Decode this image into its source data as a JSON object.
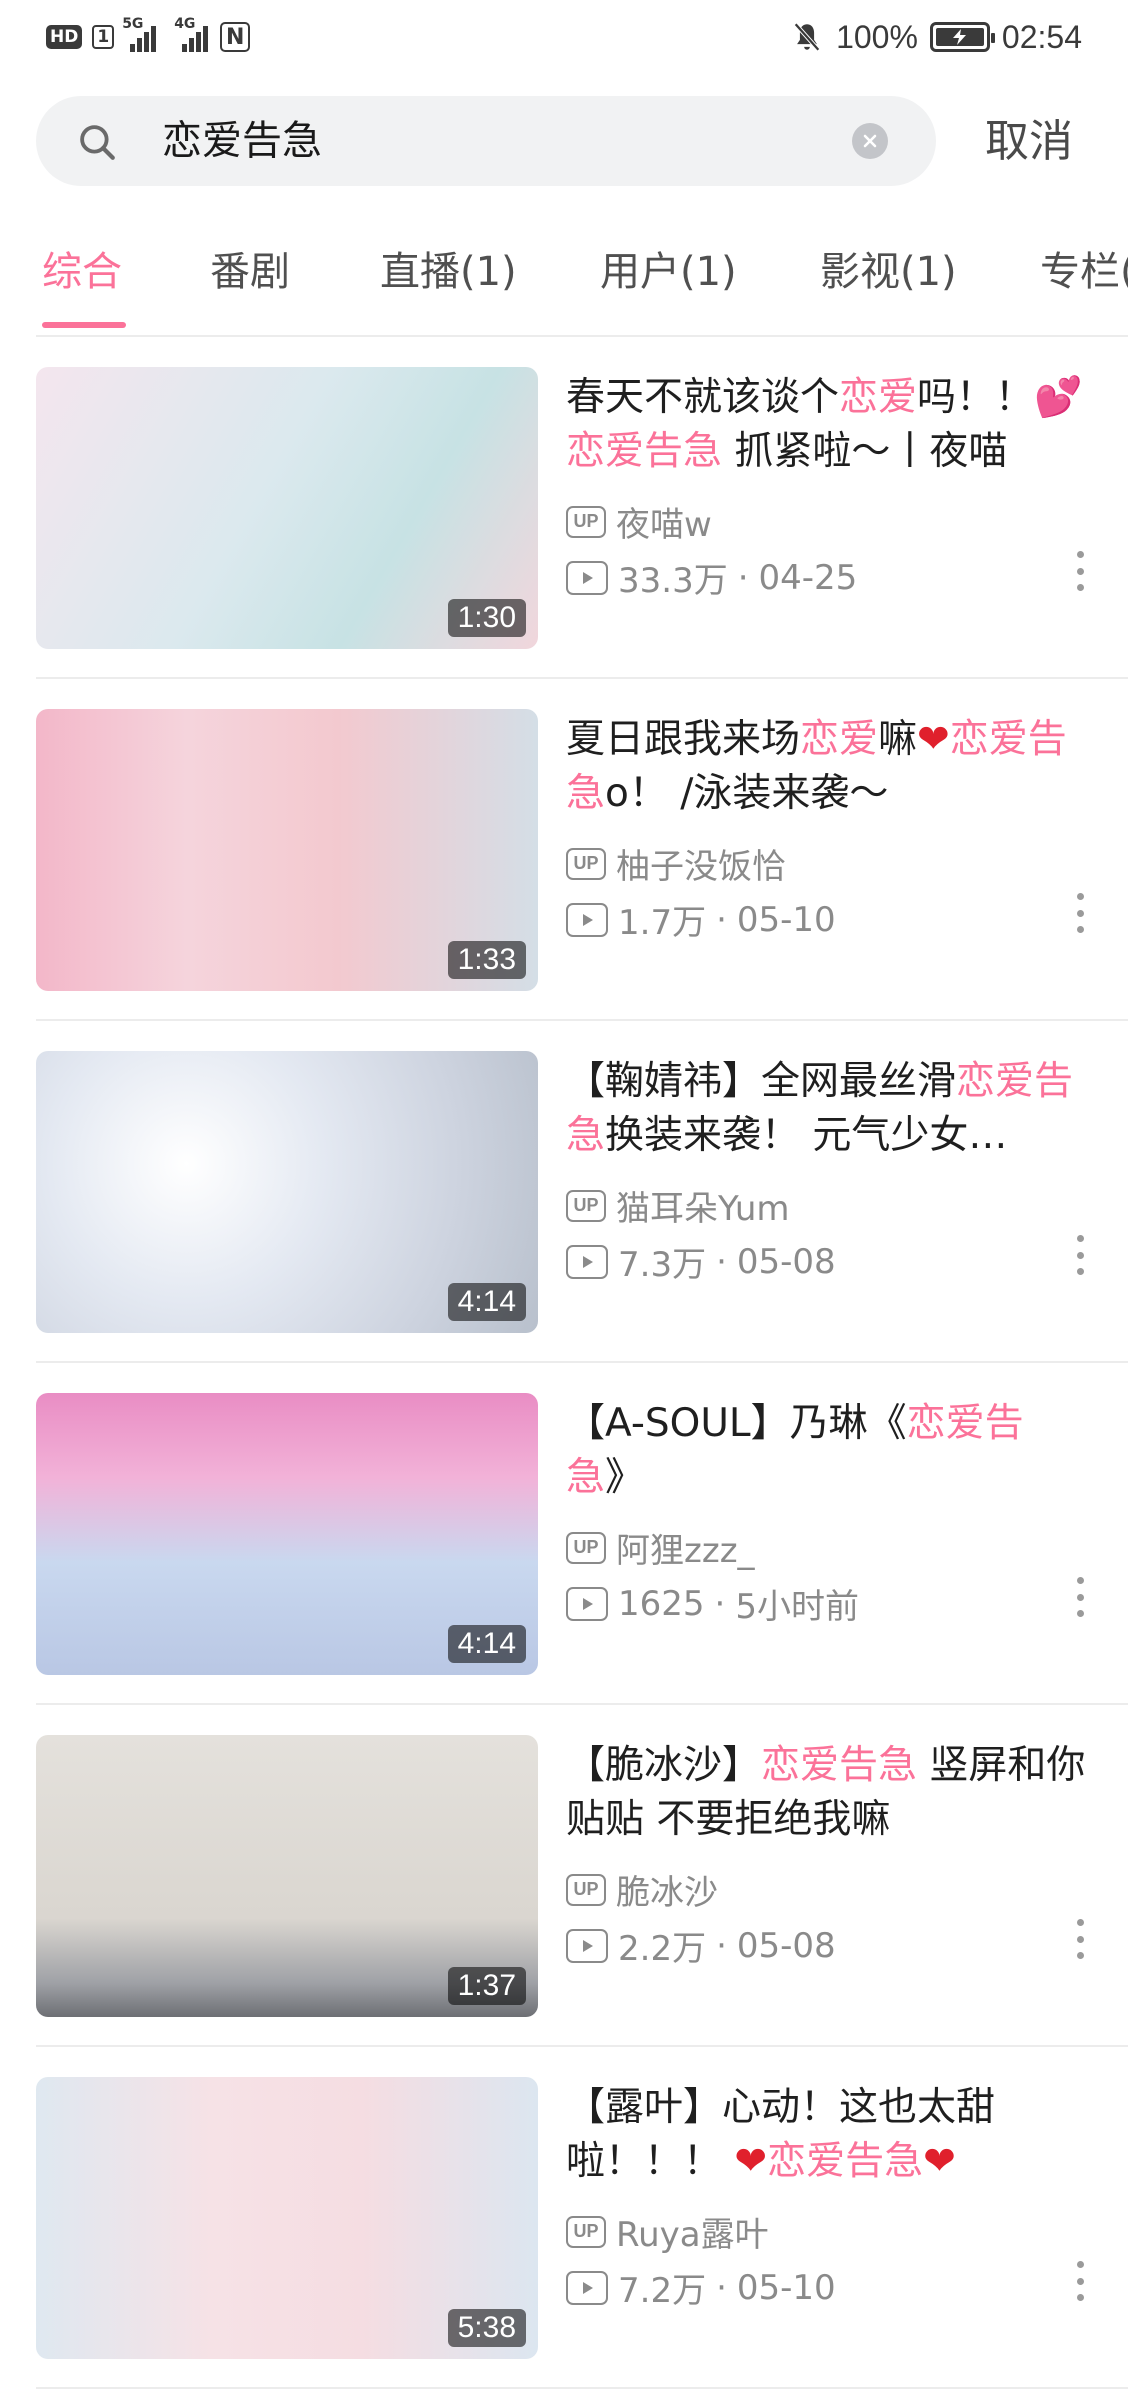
{
  "status_bar": {
    "hd": "HD",
    "sim": "1",
    "net1": "5G",
    "net2": "4G",
    "nfc": "N",
    "battery_text": "100%",
    "time": "02:54"
  },
  "search": {
    "query": "恋爱告急",
    "cancel": "取消"
  },
  "tabs": [
    {
      "label": "综合"
    },
    {
      "label": "番剧"
    },
    {
      "label": "直播(1)"
    },
    {
      "label": "用户(1)"
    },
    {
      "label": "影视(1)"
    },
    {
      "label": "专栏("
    }
  ],
  "colors": {
    "accent": "#fb7299",
    "heart": "#e0202c"
  },
  "videos": [
    {
      "title_parts": [
        {
          "t": "春天不就该谈个",
          "s": "n"
        },
        {
          "t": "恋爱",
          "s": "h"
        },
        {
          "t": "吗！！",
          "s": "n"
        },
        {
          "t": "💕",
          "s": "e"
        },
        {
          "t": "恋爱告急",
          "s": "h"
        },
        {
          "t": " 抓紧啦～丨夜喵",
          "s": "n"
        }
      ],
      "uploader": "夜喵w",
      "views": "33.3万",
      "date": "04-25",
      "duration": "1:30"
    },
    {
      "title_parts": [
        {
          "t": "夏日跟我来场",
          "s": "n"
        },
        {
          "t": "恋爱",
          "s": "h"
        },
        {
          "t": "嘛",
          "s": "n"
        },
        {
          "t": "❤",
          "s": "r"
        },
        {
          "t": "恋爱告急",
          "s": "h"
        },
        {
          "t": "o！ /泳装来袭～",
          "s": "n"
        }
      ],
      "uploader": "柚子没饭恰",
      "views": "1.7万",
      "date": "05-10",
      "duration": "1:33"
    },
    {
      "title_parts": [
        {
          "t": "【鞠婧祎】全网最丝滑",
          "s": "n"
        },
        {
          "t": "恋爱告急",
          "s": "h"
        },
        {
          "t": "换装来袭！ 元气少女…",
          "s": "n"
        }
      ],
      "uploader": "猫耳朵Yum",
      "views": "7.3万",
      "date": "05-08",
      "duration": "4:14"
    },
    {
      "title_parts": [
        {
          "t": "【A-SOUL】乃琳《",
          "s": "n"
        },
        {
          "t": "恋爱告急",
          "s": "h"
        },
        {
          "t": "》",
          "s": "n"
        }
      ],
      "uploader": "阿狸zzz_",
      "views": "1625",
      "date": "5小时前",
      "duration": "4:14"
    },
    {
      "title_parts": [
        {
          "t": "【脆冰沙】",
          "s": "n"
        },
        {
          "t": "恋爱告急",
          "s": "h"
        },
        {
          "t": " 竖屏和你贴贴 不要拒绝我嘛",
          "s": "n"
        }
      ],
      "uploader": "脆冰沙",
      "views": "2.2万",
      "date": "05-08",
      "duration": "1:37"
    },
    {
      "title_parts": [
        {
          "t": "【露叶】心动！这也太甜啦！！！ ",
          "s": "n"
        },
        {
          "t": "❤",
          "s": "r"
        },
        {
          "t": "恋爱告急",
          "s": "h"
        },
        {
          "t": "❤",
          "s": "r"
        }
      ],
      "uploader": "Ruya露叶",
      "views": "7.2万",
      "date": "05-10",
      "duration": "5:38"
    }
  ]
}
